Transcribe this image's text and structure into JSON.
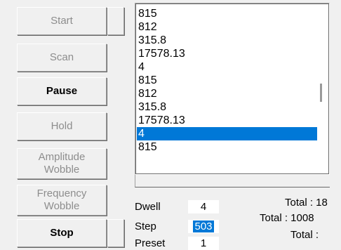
{
  "buttons": {
    "start": "Start",
    "scan": "Scan",
    "pause": "Pause",
    "hold": "Hold",
    "amplitude_wobble": "Amplitude\nWobble",
    "frequency_wobble": "Frequency\nWobble",
    "stop": "Stop"
  },
  "list": {
    "items": [
      "815",
      "812",
      "315.8",
      "17578.13",
      "4",
      "815",
      "812",
      "315.8",
      "17578.13",
      "4",
      "815"
    ],
    "selected_index": 9
  },
  "params": {
    "dwell_label": "Dwell",
    "dwell_value": "4",
    "step_label": "Step",
    "step_value": "503",
    "preset_label": "Preset",
    "preset_value": "1"
  },
  "totals": {
    "line1": "Total : 18",
    "line2": "Total : 1008",
    "line3": "Total :"
  }
}
